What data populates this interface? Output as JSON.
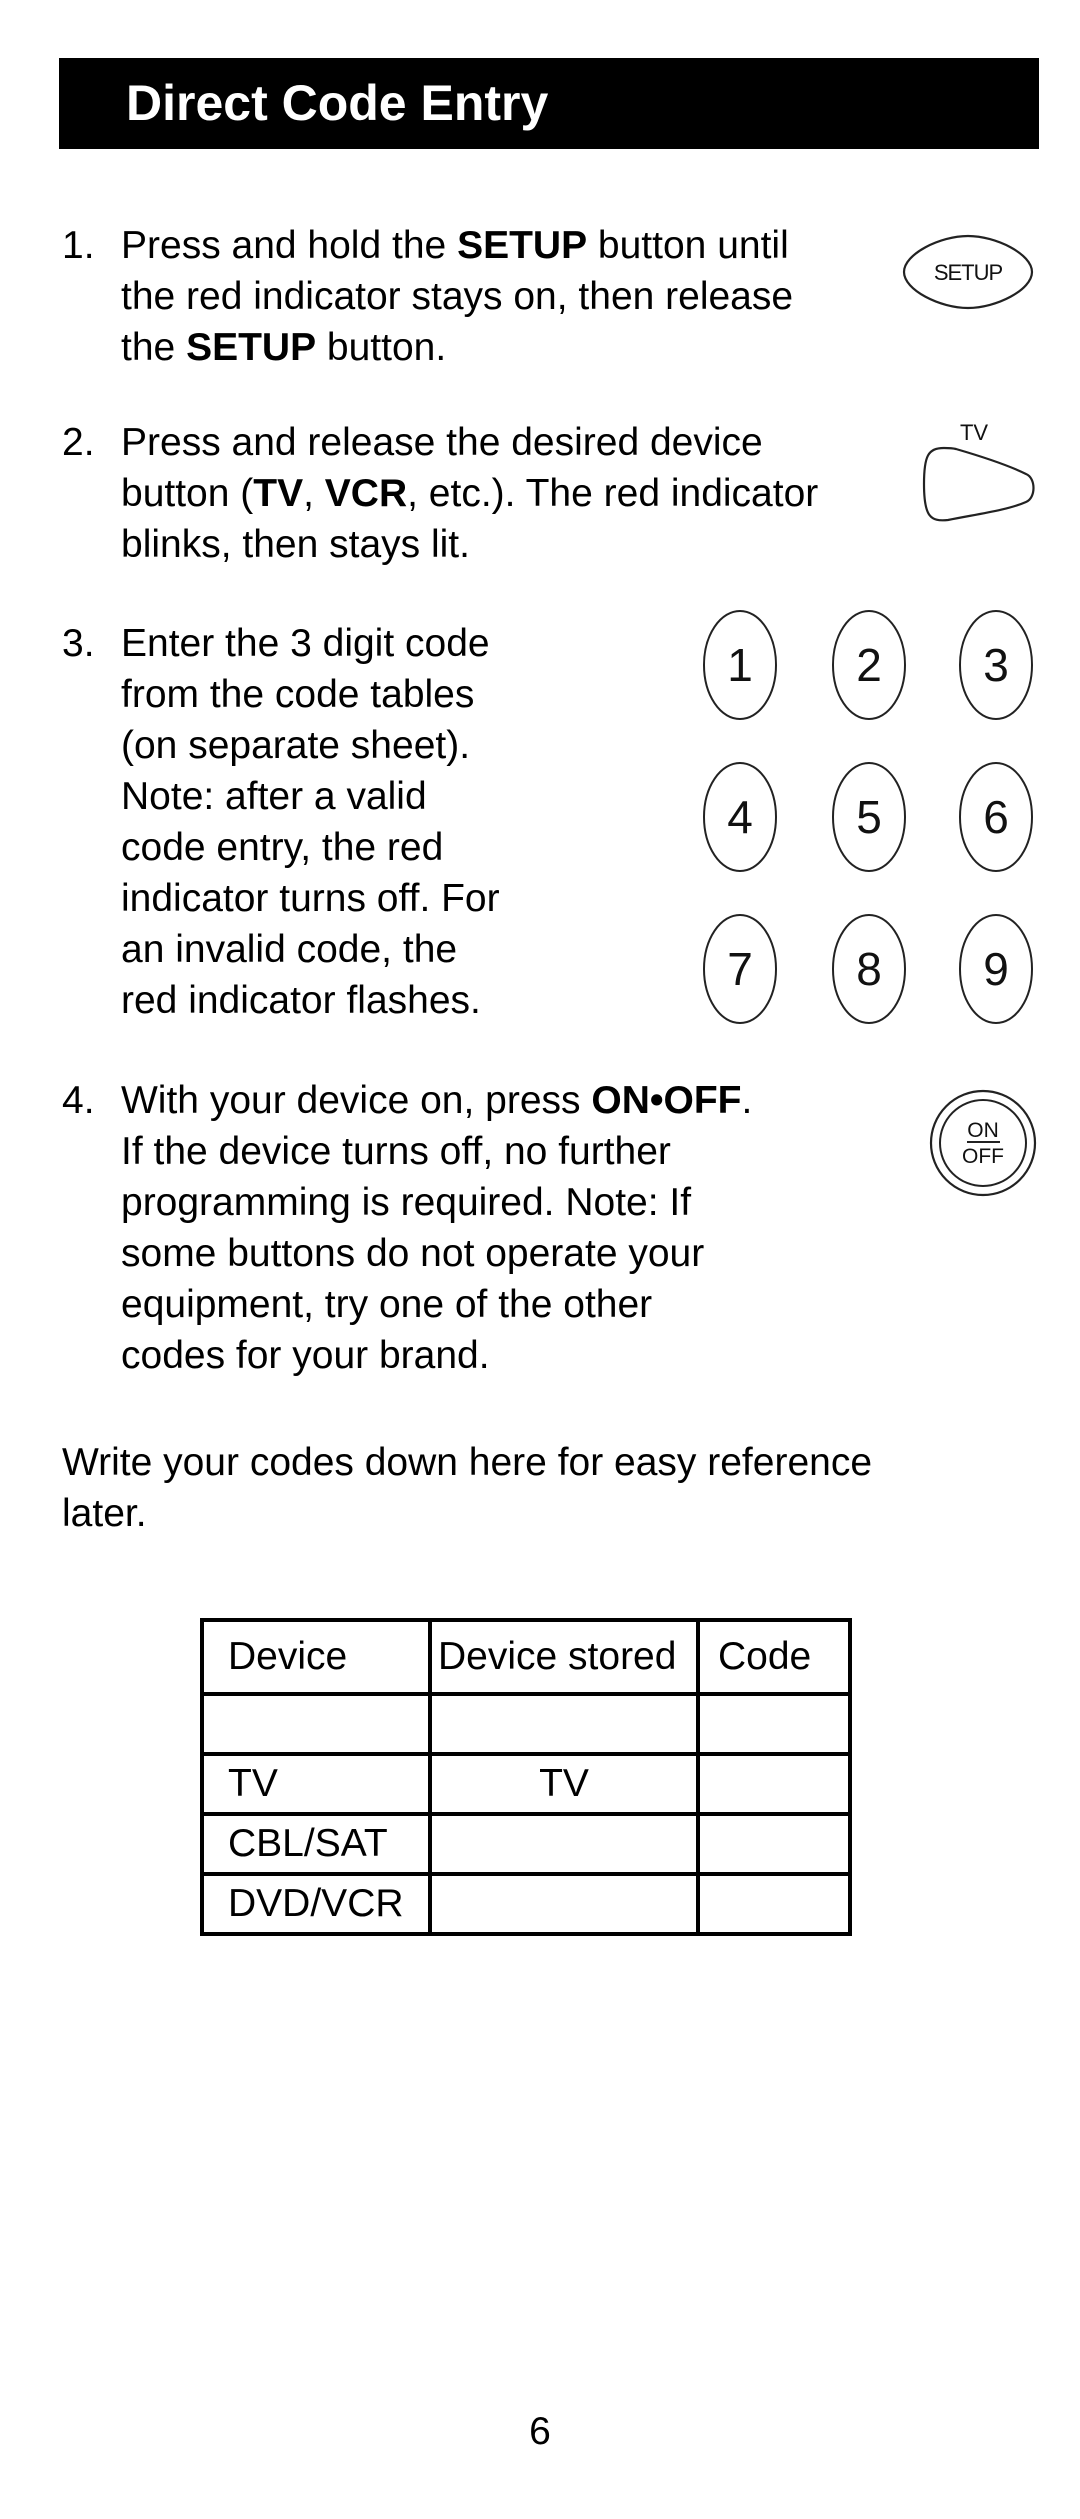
{
  "header": {
    "title": "Direct Code Entry"
  },
  "steps": [
    {
      "number": "1.",
      "lines": [
        [
          {
            "t": "Press and hold the "
          },
          {
            "t": "SETUP",
            "b": true
          },
          {
            "t": " button until"
          }
        ],
        [
          {
            "t": "the red indicator stays on, then release"
          }
        ],
        [
          {
            "t": "the "
          },
          {
            "t": "SETUP",
            "b": true
          },
          {
            "t": " button."
          }
        ]
      ],
      "icon": {
        "name": "setup-button-icon",
        "label": "SETUP"
      }
    },
    {
      "number": "2.",
      "lines": [
        [
          {
            "t": "Press and release the desired device"
          }
        ],
        [
          {
            "t": "button ("
          },
          {
            "t": "TV",
            "b": true
          },
          {
            "t": ", "
          },
          {
            "t": "VCR",
            "b": true
          },
          {
            "t": ", etc.). The red indicator"
          }
        ],
        [
          {
            "t": "blinks, then stays lit."
          }
        ]
      ],
      "icon": {
        "name": "tv-button-icon",
        "label": "TV"
      }
    },
    {
      "number": "3.",
      "lines": [
        [
          {
            "t": "Enter the 3 digit code"
          }
        ],
        [
          {
            "t": "from the code tables"
          }
        ],
        [
          {
            "t": "(on separate sheet)."
          }
        ],
        [
          {
            "t": "Note: after a valid"
          }
        ],
        [
          {
            "t": "code entry, the red"
          }
        ],
        [
          {
            "t": "indicator turns off.  For"
          }
        ],
        [
          {
            "t": "an invalid code, the"
          }
        ],
        [
          {
            "t": "red indicator flashes."
          }
        ]
      ],
      "keypad": [
        "1",
        "2",
        "3",
        "4",
        "5",
        "6",
        "7",
        "8",
        "9"
      ]
    },
    {
      "number": "4.",
      "lines": [
        [
          {
            "t": "With your device on, press "
          },
          {
            "t": "ON•OFF",
            "b": true
          },
          {
            "t": "."
          }
        ],
        [
          {
            "t": "If the device turns off, no further"
          }
        ],
        [
          {
            "t": "programming is required. Note: If"
          }
        ],
        [
          {
            "t": "some buttons do not operate your"
          }
        ],
        [
          {
            "t": "equipment, try one of the other"
          }
        ],
        [
          {
            "t": "codes for your brand."
          }
        ]
      ],
      "icon": {
        "name": "on-off-button-icon",
        "label_top": "ON",
        "label_bottom": "OFF"
      }
    }
  ],
  "reference_note": {
    "lines": [
      "Write your codes down here for easy reference",
      "later."
    ]
  },
  "code_table": {
    "headers": [
      "Device",
      "Device stored",
      "Code"
    ],
    "rows": [
      [
        "",
        "",
        ""
      ],
      [
        "TV",
        "TV",
        ""
      ],
      [
        "CBL/SAT",
        "",
        ""
      ],
      [
        "DVD/VCR",
        "",
        ""
      ]
    ]
  },
  "page_number": "6"
}
